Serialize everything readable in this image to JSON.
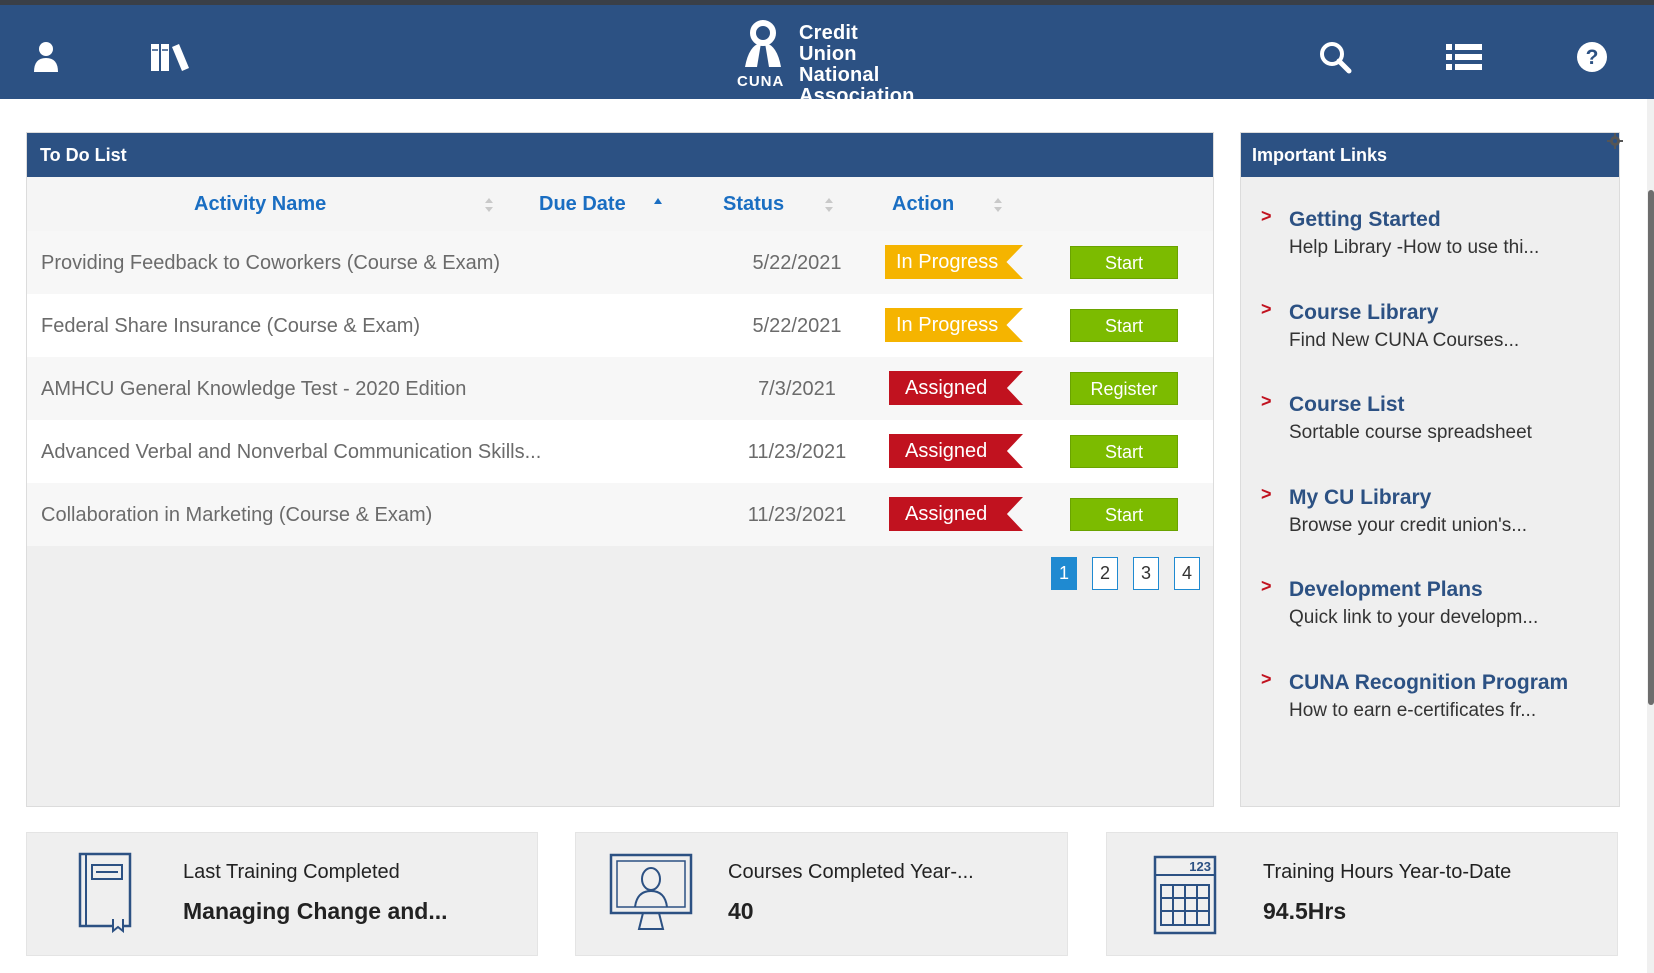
{
  "header": {
    "brand_line1": "Credit Union",
    "brand_line2": "National",
    "brand_line3": "Association",
    "brand_abbrev": "CUNA",
    "icons": [
      "user-icon",
      "library-icon",
      "search-icon",
      "menu-list-icon",
      "help-icon"
    ]
  },
  "todo": {
    "title": "To Do List",
    "columns": {
      "activity": "Activity Name",
      "due": "Due Date",
      "status": "Status",
      "action": "Action"
    },
    "rows": [
      {
        "name": "Providing Feedback to Coworkers (Course & Exam)",
        "due": "5/22/2021",
        "status": "In Progress",
        "action": "Start"
      },
      {
        "name": "Federal Share Insurance (Course & Exam)",
        "due": "5/22/2021",
        "status": "In Progress",
        "action": "Start"
      },
      {
        "name": "AMHCU General Knowledge Test - 2020 Edition",
        "due": "7/3/2021",
        "status": "Assigned",
        "action": "Register"
      },
      {
        "name": "Advanced Verbal and Nonverbal Communication Skills...",
        "due": "11/23/2021",
        "status": "Assigned",
        "action": "Start"
      },
      {
        "name": "Collaboration in Marketing (Course & Exam)",
        "due": "11/23/2021",
        "status": "Assigned",
        "action": "Start"
      }
    ],
    "pages": [
      "1",
      "2",
      "3",
      "4"
    ],
    "current_page": "1"
  },
  "links": {
    "title": "Important Links",
    "items": [
      {
        "title": "Getting Started",
        "desc": "Help Library -How to use thi..."
      },
      {
        "title": "Course Library",
        "desc": "Find New CUNA Courses..."
      },
      {
        "title": "Course List",
        "desc": "Sortable course spreadsheet"
      },
      {
        "title": "My CU Library",
        "desc": "Browse your credit union's..."
      },
      {
        "title": "Development Plans",
        "desc": "Quick link to your developm..."
      },
      {
        "title": "CUNA Recognition Program",
        "desc": "How to earn e-certificates fr..."
      }
    ],
    "chevron": ">"
  },
  "stats": {
    "last_training": {
      "label": "Last Training Completed",
      "value": "Managing Change and..."
    },
    "courses_completed": {
      "label": "Courses Completed Year-...",
      "value": "40"
    },
    "training_hours": {
      "label": "Training Hours Year-to-Date",
      "value": "94.5Hrs",
      "icon_text": "123"
    }
  },
  "colors": {
    "header_bg": "#2c5183",
    "link_blue": "#1a6ec2",
    "in_progress": "#f5b400",
    "assigned": "#c1121f",
    "action_green": "#7cbb00",
    "pager_active": "#1f8ad1"
  }
}
